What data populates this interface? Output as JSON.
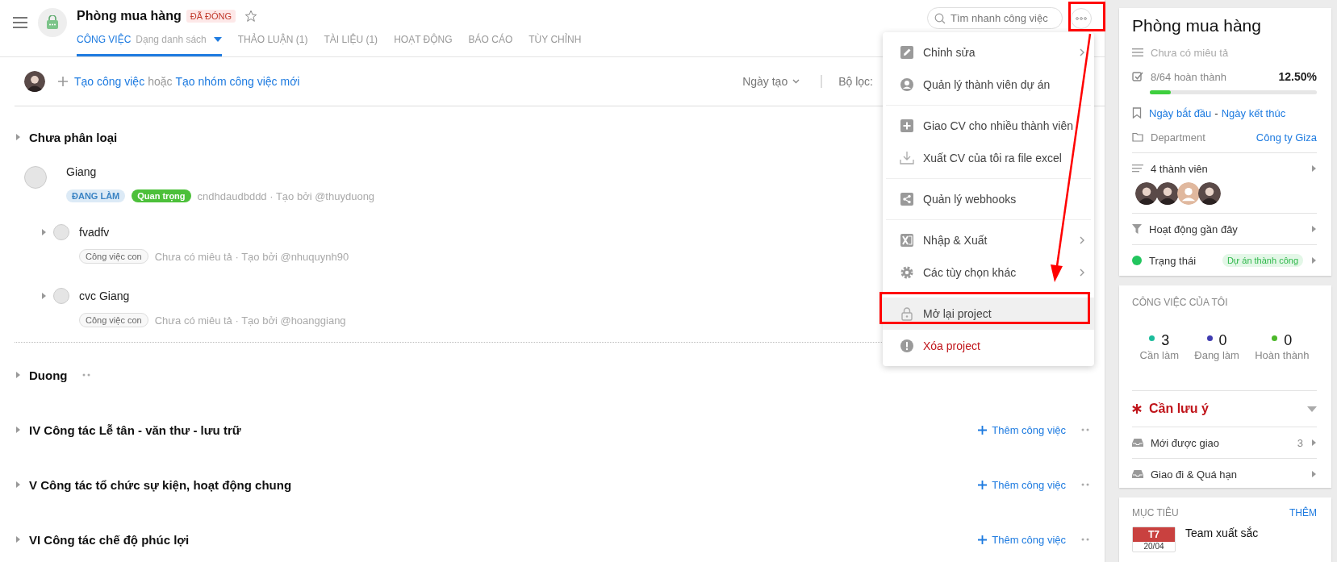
{
  "header": {
    "title": "Phòng mua hàng",
    "status_badge": "ĐÃ ĐÓNG",
    "tabs": [
      {
        "label": "CÔNG VIỆC",
        "sublabel": "Dạng danh sách",
        "selected": true
      },
      {
        "label": "THẢO LUẬN (1)",
        "selected": false
      },
      {
        "label": "TÀI LIỆU (1)",
        "selected": false
      },
      {
        "label": "HOẠT ĐỘNG",
        "selected": false
      },
      {
        "label": "BÁO CÁO",
        "selected": false
      },
      {
        "label": "TÙY CHỈNH",
        "selected": false
      }
    ],
    "search": {
      "placeholder": "Tìm nhanh công việc"
    }
  },
  "toolbar": {
    "create_link": "Tạo công việc",
    "or_text": "hoặc",
    "create_group_link": "Tạo nhóm công việc mới",
    "sort": "Ngày tạo",
    "filter_label": "Bộ lọc:"
  },
  "groups": [
    {
      "title": "Chưa phân loại",
      "tasks": [
        {
          "title": "Giang",
          "kind": "task",
          "checked": false,
          "tags": [
            {
              "label": "ĐANG LÀM",
              "kind": "status"
            },
            {
              "label": "Quan trọng",
              "kind": "priority"
            }
          ],
          "meta": "cndhdaudbddd · Tạo bởi @thuyduong"
        },
        {
          "title": "fvadfv",
          "kind": "subtask",
          "checked": false,
          "tags": [
            {
              "label": "Công việc con",
              "kind": "subtask"
            }
          ],
          "meta": "Chưa có miêu tả · Tạo bởi @nhuquynh90"
        },
        {
          "title": "cvc Giang",
          "kind": "subtask",
          "checked": false,
          "tags": [
            {
              "label": "Công việc con",
              "kind": "subtask"
            }
          ],
          "meta": "Chưa có miêu tả · Tạo bởi @hoanggiang"
        }
      ]
    },
    {
      "title": "Duong"
    },
    {
      "title": "IV Công tác Lễ tân - văn thư - lưu trữ",
      "add_label": "Thêm công việc"
    },
    {
      "title": "V Công tác tổ chức sự kiện, hoạt động chung",
      "add_label": "Thêm công việc"
    },
    {
      "title": "VI Công tác chế độ phúc lợi",
      "add_label": "Thêm công việc"
    }
  ],
  "menu": {
    "sections": [
      [
        {
          "label": "Chỉnh sửa",
          "submenu": true,
          "kind": "normal",
          "highlighted": false
        },
        {
          "label": "Quản lý thành viên dự án",
          "submenu": false,
          "kind": "normal",
          "highlighted": false
        }
      ],
      [
        {
          "label": "Giao CV cho nhiều thành viên",
          "submenu": false,
          "kind": "normal",
          "highlighted": false
        },
        {
          "label": "Xuất CV của tôi ra file excel",
          "submenu": false,
          "kind": "normal",
          "highlighted": false
        }
      ],
      [
        {
          "label": "Quản lý webhooks",
          "submenu": false,
          "kind": "normal",
          "highlighted": false
        }
      ],
      [
        {
          "label": "Nhập & Xuất",
          "submenu": true,
          "kind": "normal",
          "highlighted": false
        },
        {
          "label": "Các tùy chọn khác",
          "submenu": true,
          "kind": "normal",
          "highlighted": false
        }
      ],
      [
        {
          "label": "Mở lại project",
          "submenu": false,
          "kind": "normal",
          "highlighted": true
        },
        {
          "label": "Xóa project",
          "submenu": false,
          "kind": "danger",
          "highlighted": false
        }
      ]
    ]
  },
  "sidebar": {
    "project": {
      "title": "Phòng mua hàng",
      "description": "Chưa có miêu tả",
      "progress_label": "8/64 hoàn thành",
      "percent": "12.50%",
      "level": 0.125,
      "start_date": "Ngày bắt đầu",
      "date_separator": "-",
      "end_date": "Ngày kết thúc",
      "department_label": "Department",
      "department": "Công ty Giza",
      "members_label": "4 thành viên",
      "members": [
        {
          "kind": "photo"
        },
        {
          "kind": "photo"
        },
        {
          "kind": "placeholder"
        },
        {
          "kind": "photo"
        }
      ],
      "activity_label": "Hoạt động gần đây",
      "status_label": "Trạng thái",
      "status_badge": "Dự án thành công"
    },
    "my_tasks": {
      "title": "CÔNG VIỆC CỦA TÔI",
      "stats": [
        {
          "count": "3",
          "label": "Cần làm",
          "color": "#1bbc9b"
        },
        {
          "count": "0",
          "label": "Đang làm",
          "color": "#3f3bb0"
        },
        {
          "count": "0",
          "label": "Hoàn thành",
          "color": "#4cb82a"
        }
      ],
      "attention": "Cần lưu ý",
      "rows": [
        {
          "label": "Mới được giao",
          "count": "3"
        },
        {
          "label": "Giao đi & Quá hạn"
        }
      ]
    },
    "goals": {
      "title": "MỤC TIÊU",
      "action": "THÊM",
      "items": [
        {
          "day": "T7",
          "date": "20/04",
          "title": "Team xuất sắc"
        }
      ]
    }
  }
}
